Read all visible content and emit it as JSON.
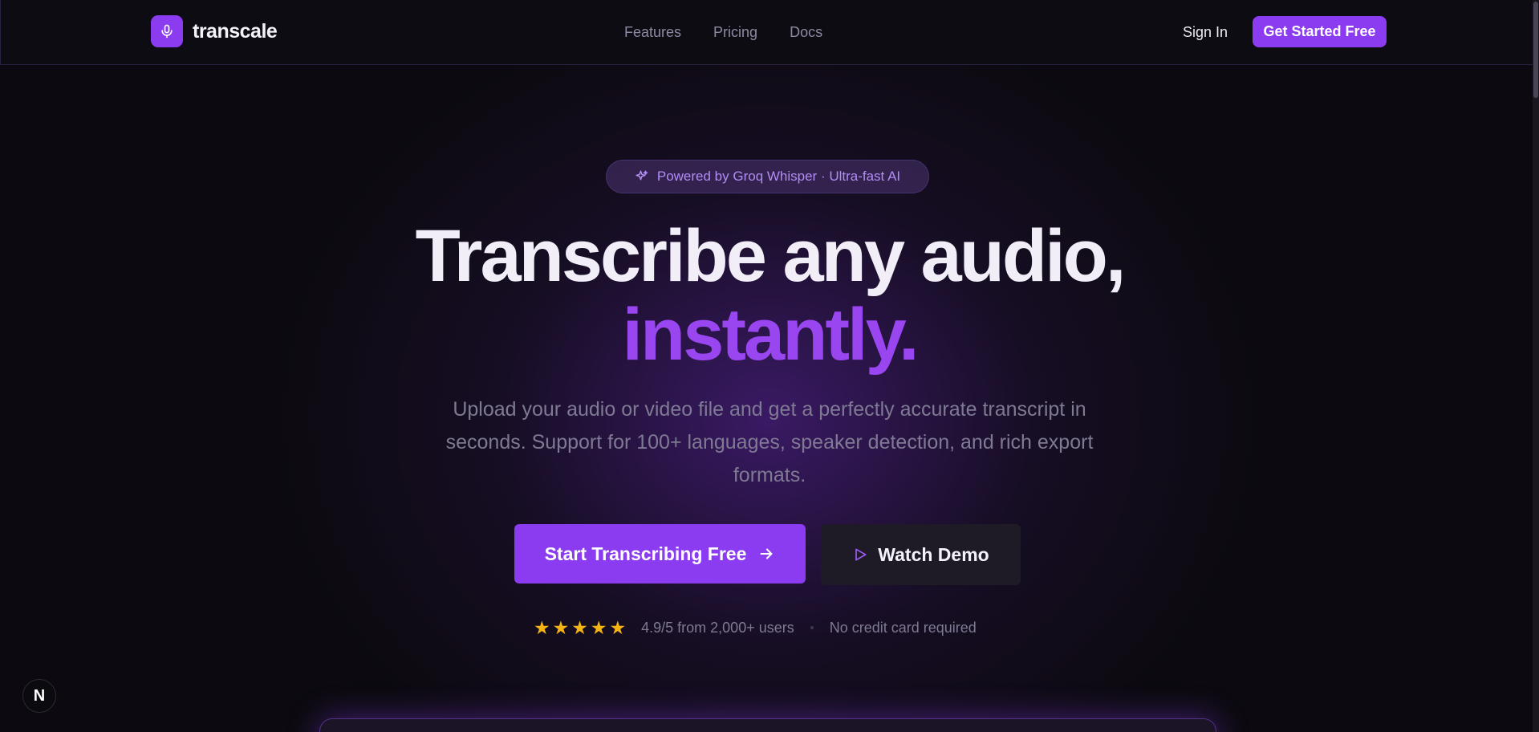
{
  "brand": {
    "name": "transcale",
    "accent": "#8b3cf0",
    "logo_icon": "microphone-icon"
  },
  "nav": {
    "links": [
      "Features",
      "Pricing",
      "Docs"
    ],
    "sign_in": "Sign In",
    "cta": "Get Started Free"
  },
  "hero": {
    "badge": "Powered by Groq Whisper · Ultra-fast AI",
    "badge_icon": "sparkles-icon",
    "headline_line1": "Transcribe any audio,",
    "headline_line2": "instantly.",
    "subtitle": "Upload your audio or video file and get a perfectly accurate transcript in seconds. Support for 100+ languages, speaker detection, and rich export formats.",
    "primary_button": "Start Transcribing Free",
    "secondary_button": "Watch Demo",
    "rating_stars": 5,
    "rating_text": "4.9/5 from 2,000+ users",
    "no_card": "No credit card required"
  },
  "framework_badge": "N"
}
